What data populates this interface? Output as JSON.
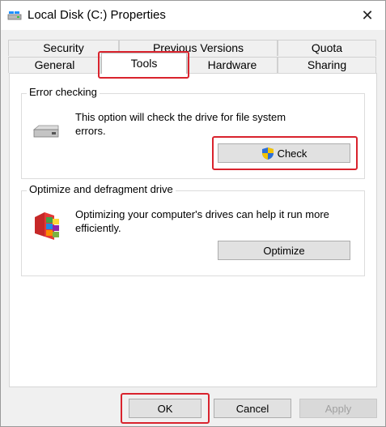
{
  "window": {
    "title": "Local Disk (C:) Properties",
    "close_label": "✕"
  },
  "tabs": {
    "row1": [
      "Security",
      "Previous Versions",
      "Quota"
    ],
    "row2": [
      "General",
      "Tools",
      "Hardware",
      "Sharing"
    ],
    "active": "Tools"
  },
  "error_checking": {
    "title": "Error checking",
    "description": "This option will check the drive for file system errors.",
    "button": "Check"
  },
  "optimize": {
    "title": "Optimize and defragment drive",
    "description": "Optimizing your computer's drives can help it run more efficiently.",
    "button": "Optimize"
  },
  "footer": {
    "ok": "OK",
    "cancel": "Cancel",
    "apply": "Apply"
  },
  "colors": {
    "highlight": "#d9232d",
    "window_bg": "#f0f0f0",
    "panel_bg": "#ffffff"
  },
  "icons": {
    "title": "drive-icon",
    "error_checking": "hard-drive-icon",
    "optimize": "defragment-icon",
    "check_button": "uac-shield-icon"
  }
}
